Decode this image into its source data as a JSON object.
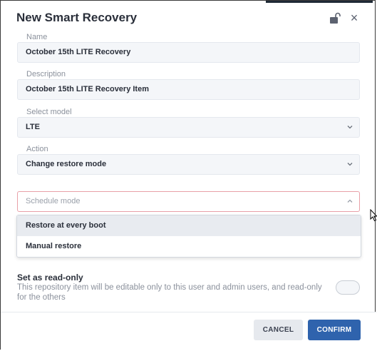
{
  "dialog": {
    "title": "New Smart Recovery",
    "close_glyph": "×"
  },
  "fields": {
    "name": {
      "label": "Name",
      "value": "October 15th LITE Recovery"
    },
    "description": {
      "label": "Description",
      "value": "October 15th LITE Recovery Item"
    },
    "model": {
      "label": "Select model",
      "value": "LTE"
    },
    "action": {
      "label": "Action",
      "value": "Change restore mode"
    },
    "schedule": {
      "placeholder": "Schedule mode"
    }
  },
  "schedule_options": [
    "Restore at every boot",
    "Manual restore"
  ],
  "read_only": {
    "title": "Set as read-only",
    "description": "This repository item will be editable only to this user and admin users, and read-only for the others",
    "enabled": false
  },
  "buttons": {
    "cancel": "CANCEL",
    "confirm": "CONFIRM"
  },
  "colors": {
    "accent": "#2f63ad",
    "error_border": "#e8a0a8"
  },
  "icons": [
    "unlock-icon",
    "close-icon",
    "chevron-down-icon",
    "chevron-up-icon",
    "mouse-cursor-icon"
  ]
}
